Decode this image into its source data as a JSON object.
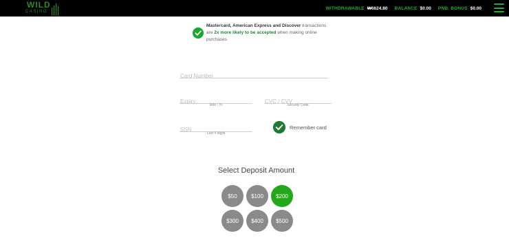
{
  "header": {
    "logo": {
      "word": "WILD",
      "sub": "CASINO"
    },
    "stats": [
      {
        "label": "Withdrawable",
        "value": "₩6624.80"
      },
      {
        "label": "Balance",
        "value": "$0.00"
      },
      {
        "label": "Pnd. Bonus",
        "value": "$0.00"
      }
    ],
    "accent_color": "#1fae34"
  },
  "notice": {
    "bold": "Mastercard, American Express and Discover",
    "text1": " transactions are ",
    "highlight": "2x more likely to be accepted",
    "text2": " when making online purchases"
  },
  "form": {
    "card_number": {
      "placeholder": "Card Number",
      "value": ""
    },
    "expiry": {
      "placeholder": "Expiry",
      "hint": "Mon / Yr",
      "value": ""
    },
    "cvc": {
      "placeholder": "CVC / CVV",
      "hint": "Security Code",
      "value": ""
    },
    "ssn": {
      "placeholder": "SSN",
      "hint": "Last 4 digits",
      "value": ""
    },
    "remember_label": "Remember card",
    "remember_checked": true
  },
  "deposit": {
    "title": "Select Deposit Amount",
    "amounts": [
      "$50",
      "$100",
      "$200",
      "$300",
      "$400",
      "$500"
    ],
    "selected": "$200",
    "selected_color": "#23a81a",
    "default_color": "#8a8a8a"
  }
}
